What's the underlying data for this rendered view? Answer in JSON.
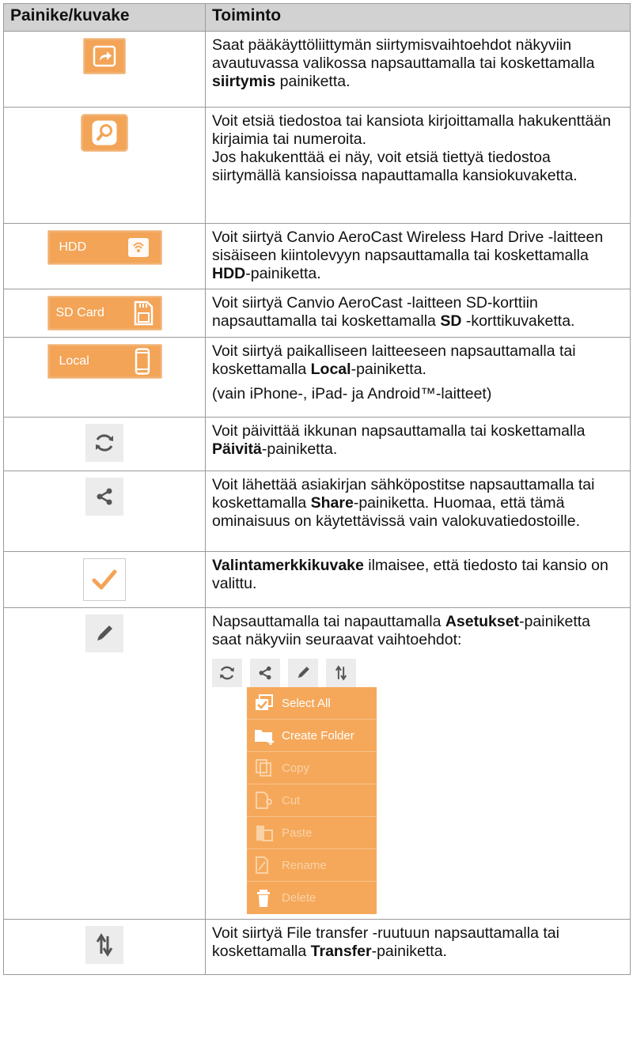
{
  "header": {
    "col1": "Painike/kuvake",
    "col2": "Toiminto"
  },
  "rows": {
    "nav": {
      "icon": "navigation-arrow-icon",
      "t1": "Saat pääkäyttöliittymän siirtymisvaihtoehdot näkyviin avautuvassa valikossa napsauttamalla tai koskettamalla ",
      "b1": "siirtymis",
      "t2": " painiketta."
    },
    "search": {
      "icon": "search-icon",
      "p1": "Voit etsiä tiedostoa tai kansiota kirjoittamalla hakukenttään kirjaimia tai numeroita.",
      "p2": "Jos hakukenttää ei näy, voit etsiä tiettyä tiedostoa siirtymällä kansioissa napauttamalla kansiokuvaketta."
    },
    "hdd": {
      "label": "HDD",
      "icon": "wireless-drive-icon",
      "t1": "Voit siirtyä Canvio AeroCast Wireless Hard Drive -laitteen sisäiseen kiintolevyyn napsauttamalla tai koskettamalla ",
      "b1": "HDD",
      "t2": "-painiketta."
    },
    "sd": {
      "label": "SD Card",
      "icon": "sd-card-icon",
      "t1": "Voit siirtyä Canvio AeroCast -laitteen SD-korttiin napsauttamalla tai koskettamalla ",
      "b1": "SD",
      "t2": " -korttikuvaketta."
    },
    "local": {
      "label": "Local",
      "icon": "phone-icon",
      "t1": "Voit siirtyä paikalliseen laitteeseen napsauttamalla tai koskettamalla ",
      "b1": "Local",
      "t2": "-painiketta.",
      "note": "(vain iPhone-, iPad- ja Android™-laitteet)"
    },
    "refresh": {
      "icon": "refresh-icon",
      "t1": "Voit päivittää ikkunan napsauttamalla tai koskettamalla ",
      "b1": "Päivitä",
      "t2": "-painiketta."
    },
    "share": {
      "icon": "share-icon",
      "t1": "Voit lähettää asiakirjan sähköpostitse napsauttamalla tai koskettamalla ",
      "b1": "Share",
      "t2": "-painiketta. Huomaa, että tämä ominaisuus on käytettävissä vain valokuvatiedostoille."
    },
    "check": {
      "icon": "checkmark-icon",
      "b1": "Valintamerkkikuvake",
      "t2": " ilmaisee, että tiedosto tai kansio on valittu."
    },
    "settings": {
      "icon": "pencil-icon",
      "t1": "Napsauttamalla tai napauttamalla ",
      "b1": "Asetukset",
      "t2": "-painiketta saat näkyviin seuraavat vaihtoehdot:",
      "menu": [
        "Select All",
        "Create Folder",
        "Copy",
        "Cut",
        "Paste",
        "Rename",
        "Delete"
      ]
    },
    "transfer": {
      "icon": "transfer-arrows-icon",
      "t1": "Voit siirtyä File transfer -ruutuun napsauttamalla tai koskettamalla ",
      "b1": "Transfer",
      "t2": "-painiketta."
    }
  },
  "colors": {
    "accent": "#f3a457",
    "header_bg": "#d2d2d2",
    "grey_button": "#ececec"
  }
}
